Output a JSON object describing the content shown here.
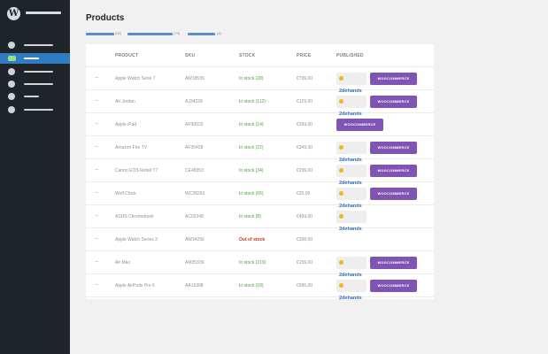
{
  "sidebar": {
    "logo": "W",
    "items": [
      {
        "active": false
      },
      {
        "active": true
      },
      {
        "active": false
      },
      {
        "active": false
      },
      {
        "active": false
      },
      {
        "active": false
      }
    ]
  },
  "header": {
    "title": "Products",
    "filters": [
      {
        "count": "(53)"
      },
      {
        "count": "(79)"
      },
      {
        "count": "(8)"
      }
    ]
  },
  "table": {
    "columns": {
      "product": "PRODUCT",
      "sku": "SKU",
      "stock": "STOCK",
      "price": "PRICE",
      "published": "PUBLISHED"
    },
    "badges": {
      "dehands": "2dehands",
      "woo": "WOOCOMMERCE"
    },
    "rows": [
      {
        "product": "Apple Watch Serie 7",
        "sku": "AW18539",
        "stock": "In stock (28)",
        "stock_status": "in",
        "price": "€799,00",
        "dehands": true,
        "woo": true
      },
      {
        "product": "Air Jordan",
        "sku": "AJ34239",
        "stock": "In stock (112)",
        "stock_status": "in",
        "price": "€129,00",
        "dehands": true,
        "woo": true
      },
      {
        "product": "Apple iPad",
        "sku": "AP30532",
        "stock": "In stock (14)",
        "stock_status": "in",
        "price": "€299,00",
        "dehands": false,
        "woo": true
      },
      {
        "product": "Amazon Fire TV",
        "sku": "AF35428",
        "stock": "In stock (22)",
        "stock_status": "in",
        "price": "€349,00",
        "dehands": true,
        "woo": true
      },
      {
        "product": "Canon EOS Rebel T7",
        "sku": "CE48353",
        "stock": "In stock (34)",
        "stock_status": "in",
        "price": "€299,00",
        "dehands": true,
        "woo": true
      },
      {
        "product": "Wolf Clock",
        "sku": "WC28250",
        "stock": "In stock (65)",
        "stock_status": "in",
        "price": "€25,00",
        "dehands": true,
        "woo": true
      },
      {
        "product": "ASUS Chromebook",
        "sku": "AC02348",
        "stock": "In stock (8)",
        "stock_status": "in",
        "price": "€499,00",
        "dehands": true,
        "woo": false
      },
      {
        "product": "Apple Watch Series 3",
        "sku": "AW34290",
        "stock": "Out of stock",
        "stock_status": "out",
        "price": "€398,00",
        "dehands": false,
        "woo": false
      },
      {
        "product": "Air Max",
        "sku": "AM35339",
        "stock": "In stock (219)",
        "stock_status": "in",
        "price": "€159,00",
        "dehands": true,
        "woo": true
      },
      {
        "product": "Apple AirPods Pro 6",
        "sku": "AA15308",
        "stock": "In stock (18)",
        "stock_status": "in",
        "price": "€995,00",
        "dehands": true,
        "woo": true
      }
    ]
  }
}
